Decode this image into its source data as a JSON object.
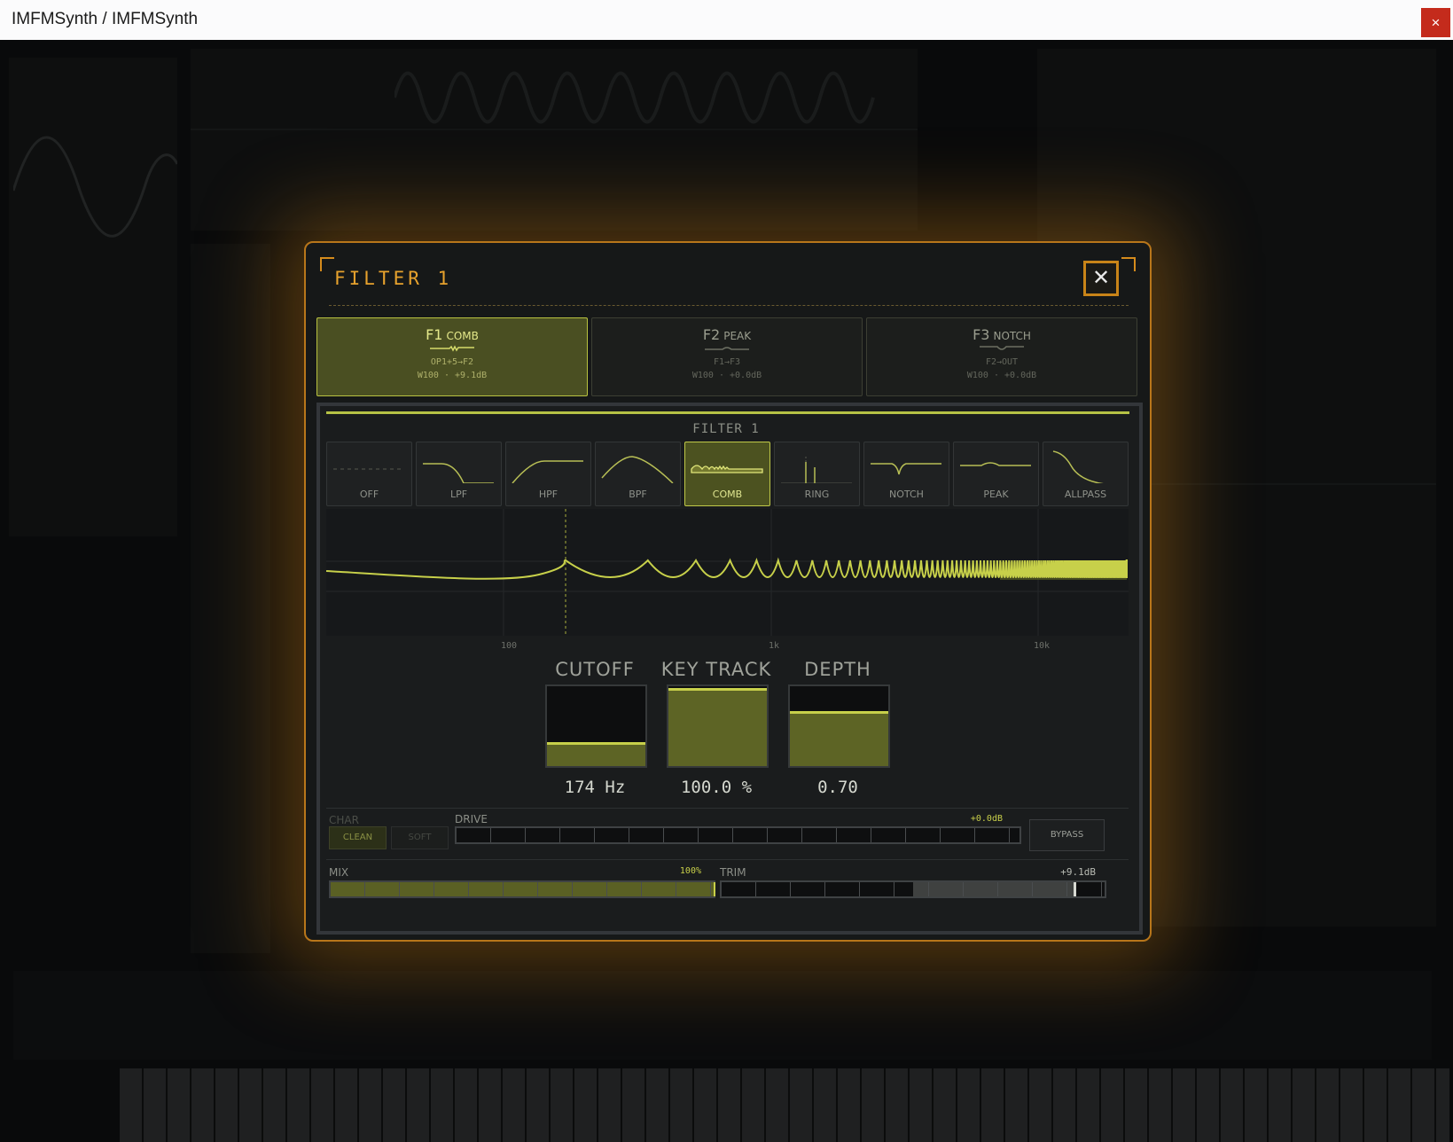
{
  "window": {
    "title": "IMFMSynth / IMFMSynth",
    "close_glyph": "×"
  },
  "modal": {
    "title": "FILTER 1",
    "close_glyph": "✕"
  },
  "tabs": [
    {
      "id": "F1",
      "name": "COMB",
      "route": "OP1+5→F2",
      "info": "W100 · +9.1dB",
      "selected": true
    },
    {
      "id": "F2",
      "name": "PEAK",
      "route": "F1→F3",
      "info": "W100 · +0.0dB",
      "selected": false
    },
    {
      "id": "F3",
      "name": "NOTCH",
      "route": "F2→OUT",
      "info": "W100 · +0.0dB",
      "selected": false
    }
  ],
  "panel": {
    "title": "FILTER 1",
    "filter_types": [
      "OFF",
      "LPF",
      "HPF",
      "BPF",
      "COMB",
      "RING",
      "NOTCH",
      "PEAK",
      "ALLPASS"
    ],
    "selected_type": "COMB",
    "freq_labels": [
      "100",
      "1k",
      "10k"
    ],
    "knobs": [
      {
        "label": "CUTOFF",
        "value": "174 Hz",
        "level": 0.28
      },
      {
        "label": "KEY TRACK",
        "value": "100.0 %",
        "level": 1.0
      },
      {
        "label": "DEPTH",
        "value": "0.70",
        "level": 0.7
      }
    ],
    "char": {
      "label": "CHAR",
      "options": [
        "CLEAN",
        "SOFT"
      ],
      "selected": "CLEAN"
    },
    "drive": {
      "label": "DRIVE",
      "value": "+0.0dB",
      "level": 0.0
    },
    "bypass_label": "BYPASS",
    "mix": {
      "label": "MIX",
      "value": "100%",
      "level": 1.0
    },
    "trim": {
      "label": "TRIM",
      "value": "+9.1dB",
      "level": 0.92
    }
  },
  "colors": {
    "accent": "#c7d04a",
    "frame": "#d58b1c",
    "close_red": "#c42b1c"
  }
}
